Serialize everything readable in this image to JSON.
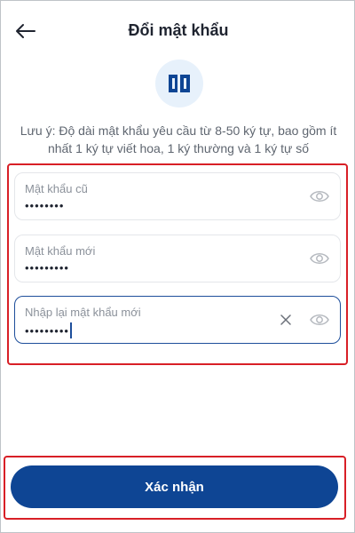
{
  "header": {
    "title": "Đổi mật khẩu",
    "back_icon": "arrow-left-icon"
  },
  "logo": {
    "icon": "bank-logo-icon",
    "color": "#0e4594",
    "background": "#e7f1fb"
  },
  "note": "Lưu ý: Độ dài mật khẩu yêu cầu từ 8-50 ký tự, bao gồm ít nhất 1 ký tự viết hoa, 1 ký thường và 1 ký tự số",
  "fields": [
    {
      "label": "Mật khẩu cũ",
      "value": "••••••••",
      "icon": "eye-icon"
    },
    {
      "label": "Mật khẩu mới",
      "value": "•••••••••",
      "icon": "eye-icon"
    },
    {
      "label": "Nhập lại mật khẩu mới",
      "value": "•••••••••",
      "icon": "eye-icon",
      "clear_icon": "clear-icon",
      "focused": true
    }
  ],
  "submit": {
    "label": "Xác nhận",
    "color": "#0e4594"
  },
  "highlight_color": "#d81f26"
}
